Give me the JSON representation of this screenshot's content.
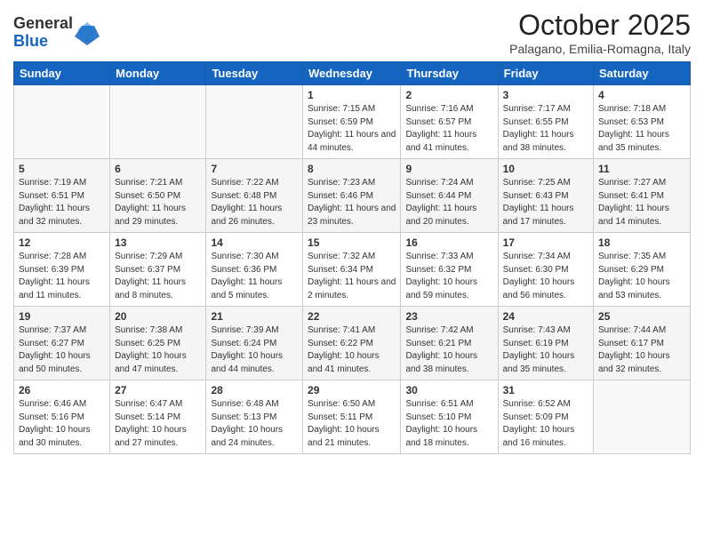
{
  "logo": {
    "general": "General",
    "blue": "Blue"
  },
  "title": "October 2025",
  "location": "Palagano, Emilia-Romagna, Italy",
  "days_of_week": [
    "Sunday",
    "Monday",
    "Tuesday",
    "Wednesday",
    "Thursday",
    "Friday",
    "Saturday"
  ],
  "weeks": [
    [
      {
        "day": "",
        "info": ""
      },
      {
        "day": "",
        "info": ""
      },
      {
        "day": "",
        "info": ""
      },
      {
        "day": "1",
        "info": "Sunrise: 7:15 AM\nSunset: 6:59 PM\nDaylight: 11 hours and 44 minutes."
      },
      {
        "day": "2",
        "info": "Sunrise: 7:16 AM\nSunset: 6:57 PM\nDaylight: 11 hours and 41 minutes."
      },
      {
        "day": "3",
        "info": "Sunrise: 7:17 AM\nSunset: 6:55 PM\nDaylight: 11 hours and 38 minutes."
      },
      {
        "day": "4",
        "info": "Sunrise: 7:18 AM\nSunset: 6:53 PM\nDaylight: 11 hours and 35 minutes."
      }
    ],
    [
      {
        "day": "5",
        "info": "Sunrise: 7:19 AM\nSunset: 6:51 PM\nDaylight: 11 hours and 32 minutes."
      },
      {
        "day": "6",
        "info": "Sunrise: 7:21 AM\nSunset: 6:50 PM\nDaylight: 11 hours and 29 minutes."
      },
      {
        "day": "7",
        "info": "Sunrise: 7:22 AM\nSunset: 6:48 PM\nDaylight: 11 hours and 26 minutes."
      },
      {
        "day": "8",
        "info": "Sunrise: 7:23 AM\nSunset: 6:46 PM\nDaylight: 11 hours and 23 minutes."
      },
      {
        "day": "9",
        "info": "Sunrise: 7:24 AM\nSunset: 6:44 PM\nDaylight: 11 hours and 20 minutes."
      },
      {
        "day": "10",
        "info": "Sunrise: 7:25 AM\nSunset: 6:43 PM\nDaylight: 11 hours and 17 minutes."
      },
      {
        "day": "11",
        "info": "Sunrise: 7:27 AM\nSunset: 6:41 PM\nDaylight: 11 hours and 14 minutes."
      }
    ],
    [
      {
        "day": "12",
        "info": "Sunrise: 7:28 AM\nSunset: 6:39 PM\nDaylight: 11 hours and 11 minutes."
      },
      {
        "day": "13",
        "info": "Sunrise: 7:29 AM\nSunset: 6:37 PM\nDaylight: 11 hours and 8 minutes."
      },
      {
        "day": "14",
        "info": "Sunrise: 7:30 AM\nSunset: 6:36 PM\nDaylight: 11 hours and 5 minutes."
      },
      {
        "day": "15",
        "info": "Sunrise: 7:32 AM\nSunset: 6:34 PM\nDaylight: 11 hours and 2 minutes."
      },
      {
        "day": "16",
        "info": "Sunrise: 7:33 AM\nSunset: 6:32 PM\nDaylight: 10 hours and 59 minutes."
      },
      {
        "day": "17",
        "info": "Sunrise: 7:34 AM\nSunset: 6:30 PM\nDaylight: 10 hours and 56 minutes."
      },
      {
        "day": "18",
        "info": "Sunrise: 7:35 AM\nSunset: 6:29 PM\nDaylight: 10 hours and 53 minutes."
      }
    ],
    [
      {
        "day": "19",
        "info": "Sunrise: 7:37 AM\nSunset: 6:27 PM\nDaylight: 10 hours and 50 minutes."
      },
      {
        "day": "20",
        "info": "Sunrise: 7:38 AM\nSunset: 6:25 PM\nDaylight: 10 hours and 47 minutes."
      },
      {
        "day": "21",
        "info": "Sunrise: 7:39 AM\nSunset: 6:24 PM\nDaylight: 10 hours and 44 minutes."
      },
      {
        "day": "22",
        "info": "Sunrise: 7:41 AM\nSunset: 6:22 PM\nDaylight: 10 hours and 41 minutes."
      },
      {
        "day": "23",
        "info": "Sunrise: 7:42 AM\nSunset: 6:21 PM\nDaylight: 10 hours and 38 minutes."
      },
      {
        "day": "24",
        "info": "Sunrise: 7:43 AM\nSunset: 6:19 PM\nDaylight: 10 hours and 35 minutes."
      },
      {
        "day": "25",
        "info": "Sunrise: 7:44 AM\nSunset: 6:17 PM\nDaylight: 10 hours and 32 minutes."
      }
    ],
    [
      {
        "day": "26",
        "info": "Sunrise: 6:46 AM\nSunset: 5:16 PM\nDaylight: 10 hours and 30 minutes."
      },
      {
        "day": "27",
        "info": "Sunrise: 6:47 AM\nSunset: 5:14 PM\nDaylight: 10 hours and 27 minutes."
      },
      {
        "day": "28",
        "info": "Sunrise: 6:48 AM\nSunset: 5:13 PM\nDaylight: 10 hours and 24 minutes."
      },
      {
        "day": "29",
        "info": "Sunrise: 6:50 AM\nSunset: 5:11 PM\nDaylight: 10 hours and 21 minutes."
      },
      {
        "day": "30",
        "info": "Sunrise: 6:51 AM\nSunset: 5:10 PM\nDaylight: 10 hours and 18 minutes."
      },
      {
        "day": "31",
        "info": "Sunrise: 6:52 AM\nSunset: 5:09 PM\nDaylight: 10 hours and 16 minutes."
      },
      {
        "day": "",
        "info": ""
      }
    ]
  ]
}
